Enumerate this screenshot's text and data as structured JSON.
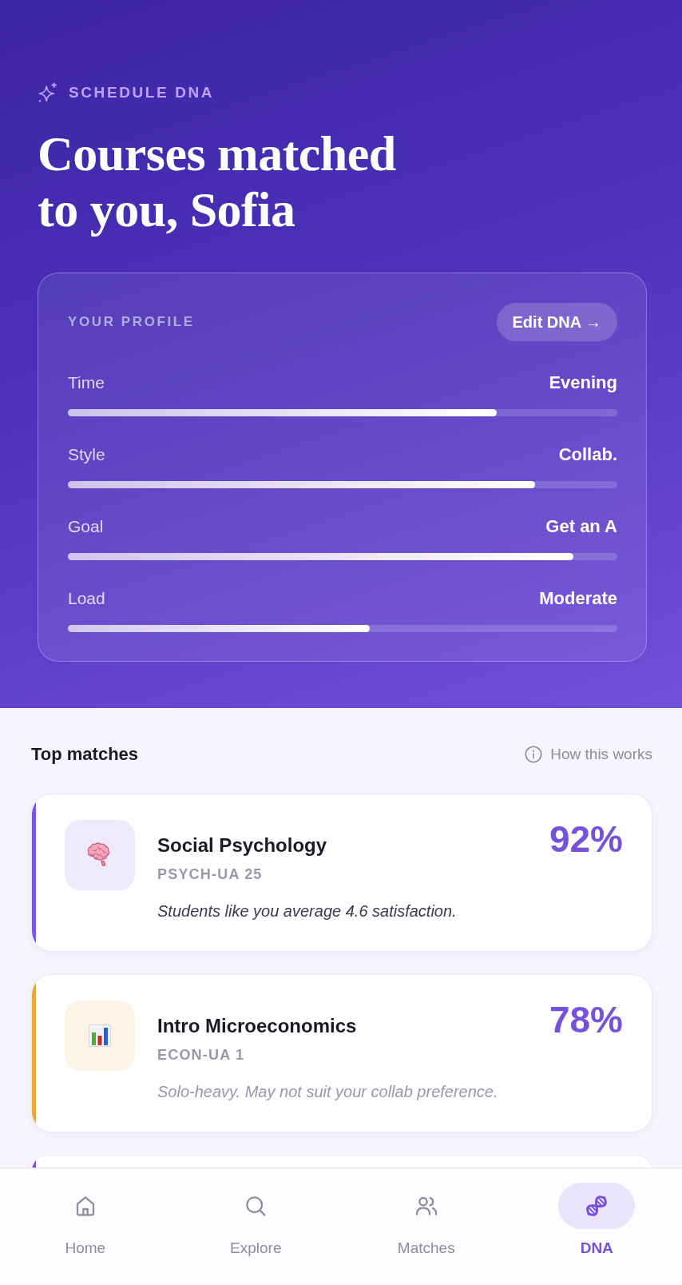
{
  "header": {
    "eyebrow": "SCHEDULE DNA",
    "title": "Courses matched to you, Sofia"
  },
  "profile": {
    "heading": "YOUR PROFILE",
    "edit_button": "Edit DNA →",
    "traits": [
      {
        "label": "Time",
        "value": "Evening",
        "level": 0.78
      },
      {
        "label": "Style",
        "value": "Collab.",
        "level": 0.85
      },
      {
        "label": "Goal",
        "value": "Get an A",
        "level": 0.92
      },
      {
        "label": "Load",
        "value": "Moderate",
        "level": 0.55
      }
    ]
  },
  "matches": {
    "heading": "Top matches",
    "help_link": "How this works",
    "cards": [
      {
        "title": "Social Psychology",
        "code": "PSYCH-UA 25",
        "note": "Students like you average 4.6 satisfaction.",
        "score": "92%",
        "color": "#7b55e0",
        "caution": false
      },
      {
        "title": "Intro Microeconomics",
        "code": "ECON-UA 1",
        "note": "Solo-heavy. May not suit your collab preference.",
        "score": "78%",
        "color": "#e6a93a",
        "caution": true
      },
      {
        "color": "#7b55e0"
      }
    ]
  },
  "nav": [
    {
      "label": "Home",
      "selected": false
    },
    {
      "label": "Explore",
      "selected": false
    },
    {
      "label": "Matches",
      "selected": false
    },
    {
      "label": "DNA",
      "selected": true
    }
  ]
}
